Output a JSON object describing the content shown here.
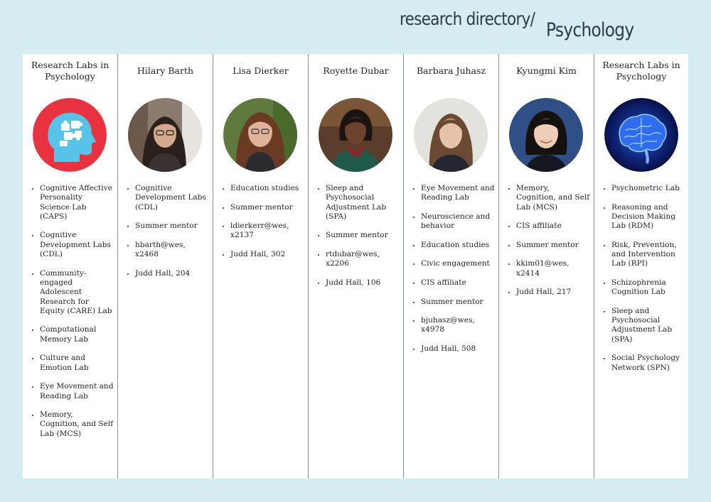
{
  "header": {
    "breadcrumb": "research directory/",
    "department": "Psychology"
  },
  "columns": [
    {
      "title": "Research Labs in Psychology",
      "image": "puzzle-head-icon",
      "items": [
        "Cognitive Affective Personality Science Lab (CAPS)",
        "Cognitive Development Labs (CDL)",
        "Community-engaged Adolescent Research for Equity (CARE) Lab",
        "Computational Memory Lab",
        "Culture and Emotion Lab",
        "Eye Movement and Reading Lab",
        "Memory, Cognition, and Self Lab (MCS)"
      ]
    },
    {
      "title": "Hilary Barth",
      "image": "faculty-photo",
      "items": [
        "Cognitive Development Labs (CDL)",
        "Summer mentor",
        "hbarth@wes, x2468",
        "Judd Hall, 204"
      ]
    },
    {
      "title": "Lisa Dierker",
      "image": "faculty-photo",
      "items": [
        "Education studies",
        "Summer mentor",
        "ldierkerr@wes, x2137",
        "Judd Hall, 302"
      ]
    },
    {
      "title": "Royette Dubar",
      "image": "faculty-photo",
      "items": [
        "Sleep and Psychosocial Adjustment Lab (SPA)",
        "Summer mentor",
        "rtdubar@wes, x2206",
        "Judd Hall, 106"
      ]
    },
    {
      "title": "Barbara Juhasz",
      "image": "faculty-photo",
      "items": [
        "Eye Movement and Reading Lab",
        "Neuroscience and behavior",
        "Education studies",
        "Civic engagement",
        "CIS affiliate",
        "Summer mentor",
        "bjuhasz@wes, x4978",
        "Judd Hall, 508"
      ]
    },
    {
      "title": "Kyungmi Kim",
      "image": "faculty-photo",
      "items": [
        "Memory, Cognition, and Self Lab (MCS)",
        "CIS affiliate",
        "Summer mentor",
        "kkim01@wes, x2414",
        "Judd Hall, 217"
      ]
    },
    {
      "title": "Research Labs in Psychology",
      "image": "brain-icon",
      "items": [
        "Psychometric Lab",
        "Reasoning and Decision Making Lab (RDM)",
        "Risk, Prevention, and Intervention Lab (RPI)",
        "Schizophrenia Cognition Lab",
        "Sleep and Psychosocial Adjustment Lab (SPA)",
        "Social Psychology Network (SPN)"
      ]
    }
  ],
  "colors": {
    "page_bg": "#d5ecf3",
    "board_bg": "#ffffff",
    "divider": "#7d93a3",
    "puzzle_bg": "#e8323f",
    "puzzle_head": "#57c3e8",
    "brain_bg": "#0a1a5c"
  }
}
